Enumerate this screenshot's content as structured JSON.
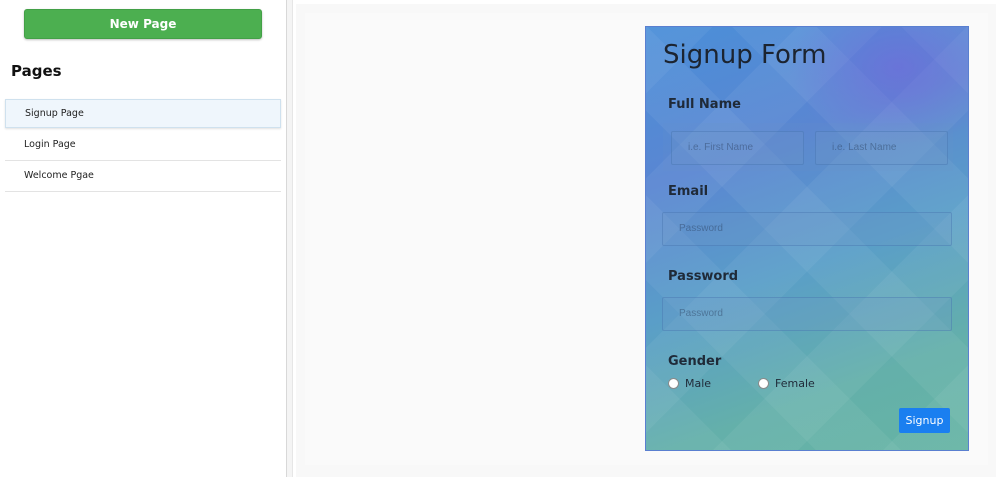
{
  "sidebar": {
    "new_page_label": "New Page",
    "heading": "Pages",
    "items": [
      {
        "label": "Signup Page",
        "active": true
      },
      {
        "label": "Login Page",
        "active": false
      },
      {
        "label": "Welcome Pgae",
        "active": false
      }
    ]
  },
  "form": {
    "title": "Signup Form",
    "full_name_label": "Full Name",
    "first_name_placeholder": "i.e. First Name",
    "last_name_placeholder": "i.e. Last Name",
    "email_label": "Email",
    "email_placeholder": "Password",
    "password_label": "Password",
    "password_placeholder": "Password",
    "gender_label": "Gender",
    "gender_options": [
      "Male",
      "Female"
    ],
    "submit_label": "Signup"
  },
  "colors": {
    "new_page_button": "#4caf50",
    "signup_button": "#1a7ff0",
    "active_item_bg": "#eff6fc"
  }
}
